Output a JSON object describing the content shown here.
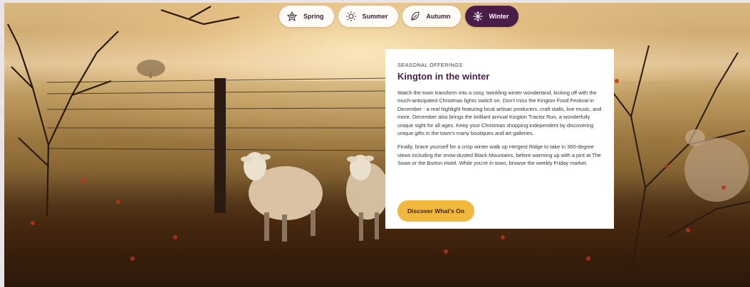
{
  "season_tabs": [
    {
      "label": "Spring",
      "icon": "flower-icon",
      "active": false
    },
    {
      "label": "Summer",
      "icon": "sun-icon",
      "active": false
    },
    {
      "label": "Autumn",
      "icon": "leaf-icon",
      "active": false
    },
    {
      "label": "Winter",
      "icon": "snowflake-icon",
      "active": true
    }
  ],
  "card": {
    "eyebrow": "SEASONAL OFFERINGS",
    "title": "Kington in the winter",
    "paragraphs": [
      "Watch the town transform into a cosy, twinkling winter wonderland, kicking off with the much-anticipated Christmas lights switch on. Don't miss the Kington Food Festival in December - a real highlight featuring local artisan producers, craft stalls, live music, and more. December also brings the brilliant annual Kington Tractor Run, a wonderfully unique sight for all ages. Keep your Christmas shopping independent by discovering unique gifts in the town's many boutiques and art galleries.",
      "Finally, brace yourself for a crisp winter walk up Hergest Ridge to take in 360-degree views including the snow-dusted Black Mountains, before warming up with a pint at The Swan or the Burton Hotel. While you're in town, browse the weekly Friday market."
    ],
    "cta_label": "Discover What's On"
  },
  "colors": {
    "brand_purple": "#4a1c48",
    "cta_yellow": "#f2b73d",
    "card_bg": "#ffffff"
  }
}
